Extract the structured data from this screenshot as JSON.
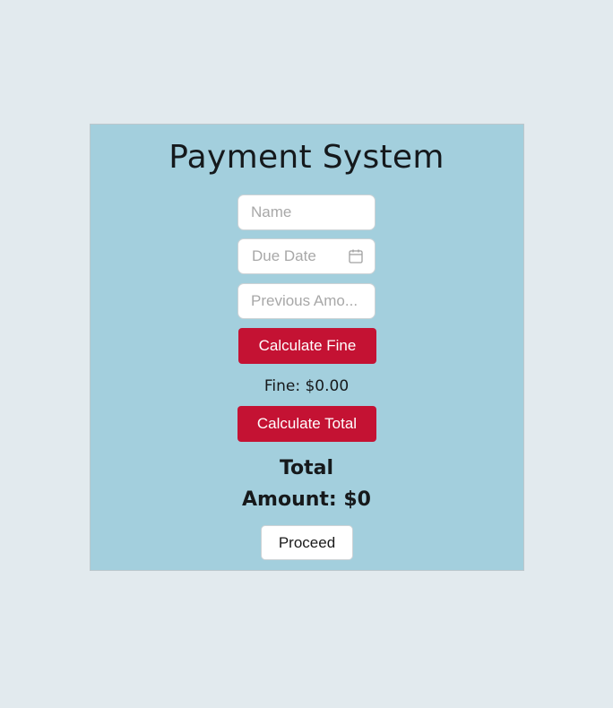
{
  "page": {
    "title": "Payment System"
  },
  "form": {
    "name_placeholder": "Name",
    "name_value": "",
    "due_date_placeholder": "Due Date",
    "due_date_value": "",
    "previous_amount_placeholder": "Previous Amo...",
    "previous_amount_value": ""
  },
  "buttons": {
    "calculate_fine": "Calculate Fine",
    "calculate_total": "Calculate Total",
    "proceed": "Proceed"
  },
  "results": {
    "fine_label": "Fine: $0.00",
    "total_line1": "Total",
    "total_line2": "Amount: $0"
  },
  "icons": {
    "due_date": "calendar-icon"
  },
  "colors": {
    "page_background": "#e2eaee",
    "card_background": "#a3cfdd",
    "primary_button": "#c41233"
  }
}
